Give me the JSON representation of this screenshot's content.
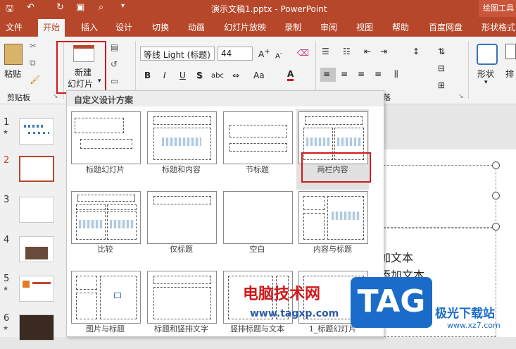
{
  "window": {
    "title": "演示文稿1.pptx  -  PowerPoint",
    "context_tab": "绘图工具"
  },
  "tabs": [
    "文件",
    "开始",
    "插入",
    "设计",
    "切换",
    "动画",
    "幻灯片放映",
    "录制",
    "审阅",
    "视图",
    "帮助",
    "百度网盘",
    "形状格式"
  ],
  "ribbon": {
    "paste": "粘贴",
    "clipboard": "剪贴板",
    "new_slide_line1": "新建",
    "new_slide_line2": "幻灯片",
    "font_name": "等线 Light (标题)",
    "font_size": "44",
    "bold": "B",
    "italic": "I",
    "underline": "U",
    "shadow": "S",
    "spacing": "abc",
    "aa": "Aa",
    "font_color": "A",
    "paragraph_partial": "落",
    "shape": "形状",
    "arrange_partial": "排"
  },
  "gallery": {
    "header": "自定义设计方案",
    "layouts": [
      "标题幻灯片",
      "标题和内容",
      "节标题",
      "两栏内容",
      "比较",
      "仅标题",
      "空白",
      "内容与标题",
      "图片与标题",
      "标题和竖排文字",
      "竖排标题与文本",
      "1_标题幻灯片"
    ]
  },
  "thumbnails": [
    "1",
    "2",
    "3",
    "4",
    "5",
    "6"
  ],
  "slide": {
    "text1": "加文本",
    "text2": "添加文本"
  },
  "watermark": {
    "line1": "电脑技术网",
    "line2": "www.tagxp.com",
    "badge": "TAG",
    "site": "极光下载站",
    "url": "www.xz7.com"
  }
}
